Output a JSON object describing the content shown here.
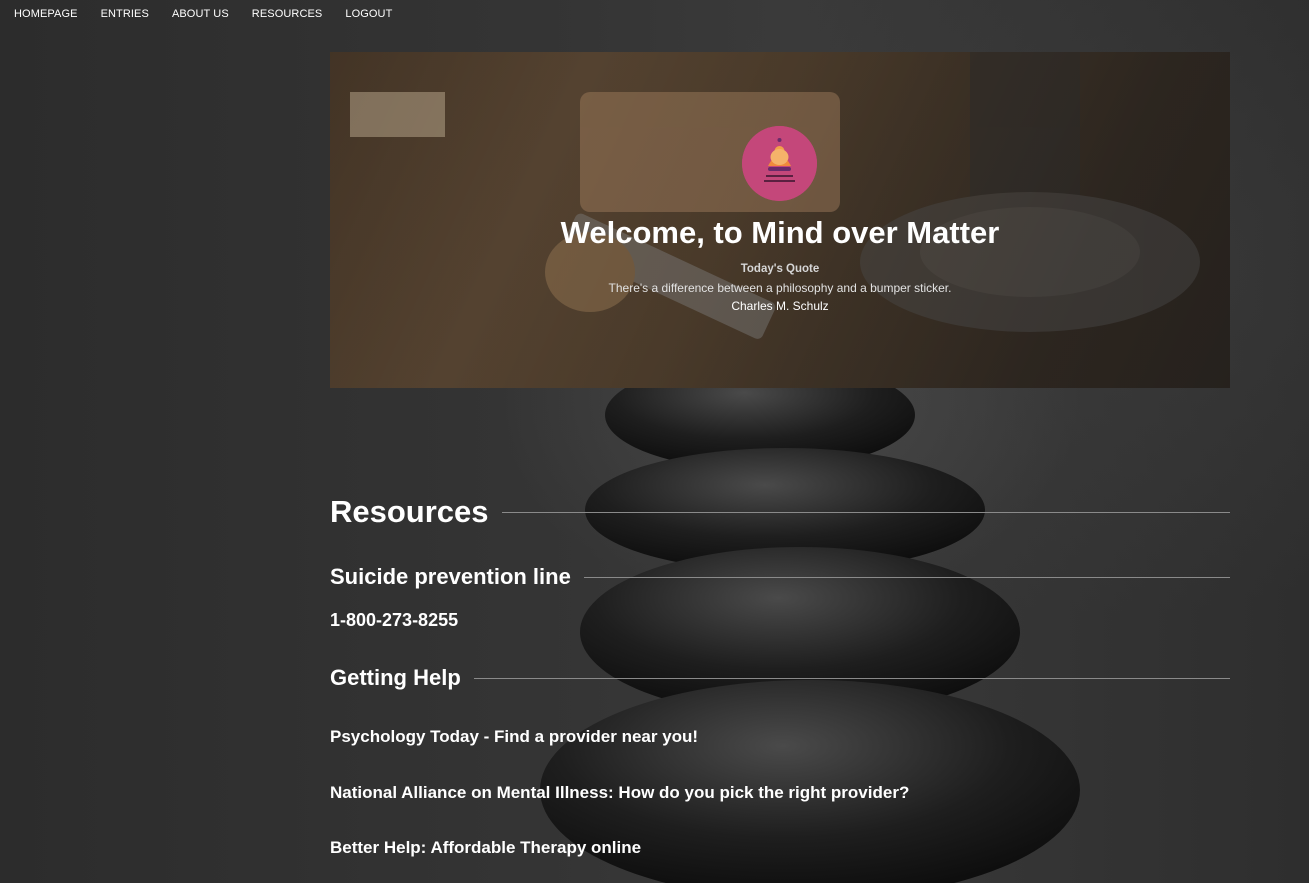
{
  "nav": {
    "items": [
      "HOMEPAGE",
      "ENTRIES",
      "ABOUT US",
      "RESOURCES",
      "LOGOUT"
    ]
  },
  "hero": {
    "logo_icon": "meditation-logo-icon",
    "title": "Welcome, to Mind over Matter",
    "quote_label": "Today's Quote",
    "quote_text": "There's a difference between a philosophy and a bumper sticker.",
    "quote_author": "Charles M. Schulz"
  },
  "resources": {
    "heading": "Resources",
    "suicide_heading": "Suicide prevention line",
    "suicide_phone": "1-800-273-8255",
    "help_heading": "Getting Help",
    "links": [
      "Psychology Today - Find a provider near you!",
      "National Alliance on Mental Illness: How do you pick the right provider?",
      "Better Help: Affordable Therapy online"
    ]
  },
  "colors": {
    "logo_background": "#c4477a",
    "text": "#ffffff",
    "rule": "#8a8a8a"
  }
}
